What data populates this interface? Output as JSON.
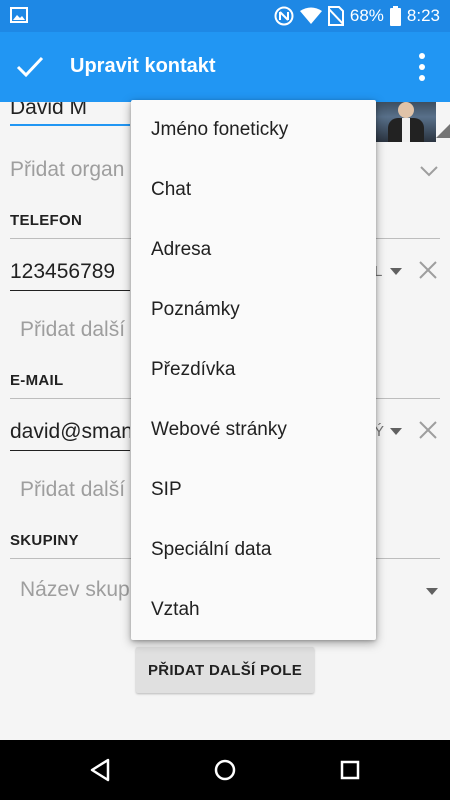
{
  "status_bar": {
    "battery": "68%",
    "time": "8:23"
  },
  "app_bar": {
    "title": "Upravit kontakt"
  },
  "form": {
    "name_value": "David M",
    "organization_placeholder": "Přidat organ",
    "phone_section": "TELEFON",
    "phone_value": "123456789",
    "phone_type_tail": "L",
    "phone_add_more": "Přidat další",
    "email_section": "E-MAIL",
    "email_value": "david@sman",
    "email_type_tail": "Ý",
    "email_add_more": "Přidat další",
    "groups_section": "SKUPINY",
    "groups_placeholder": "Název skup",
    "add_field_button": "PŘIDAT DALŠÍ POLE"
  },
  "menu": {
    "items": [
      "Jméno foneticky",
      "Chat",
      "Adresa",
      "Poznámky",
      "Přezdívka",
      "Webové stránky",
      "SIP",
      "Speciální data",
      "Vztah"
    ]
  },
  "colors": {
    "status_bar": "#1e88e5",
    "app_bar": "#2196f3",
    "accent": "#2196f3"
  }
}
